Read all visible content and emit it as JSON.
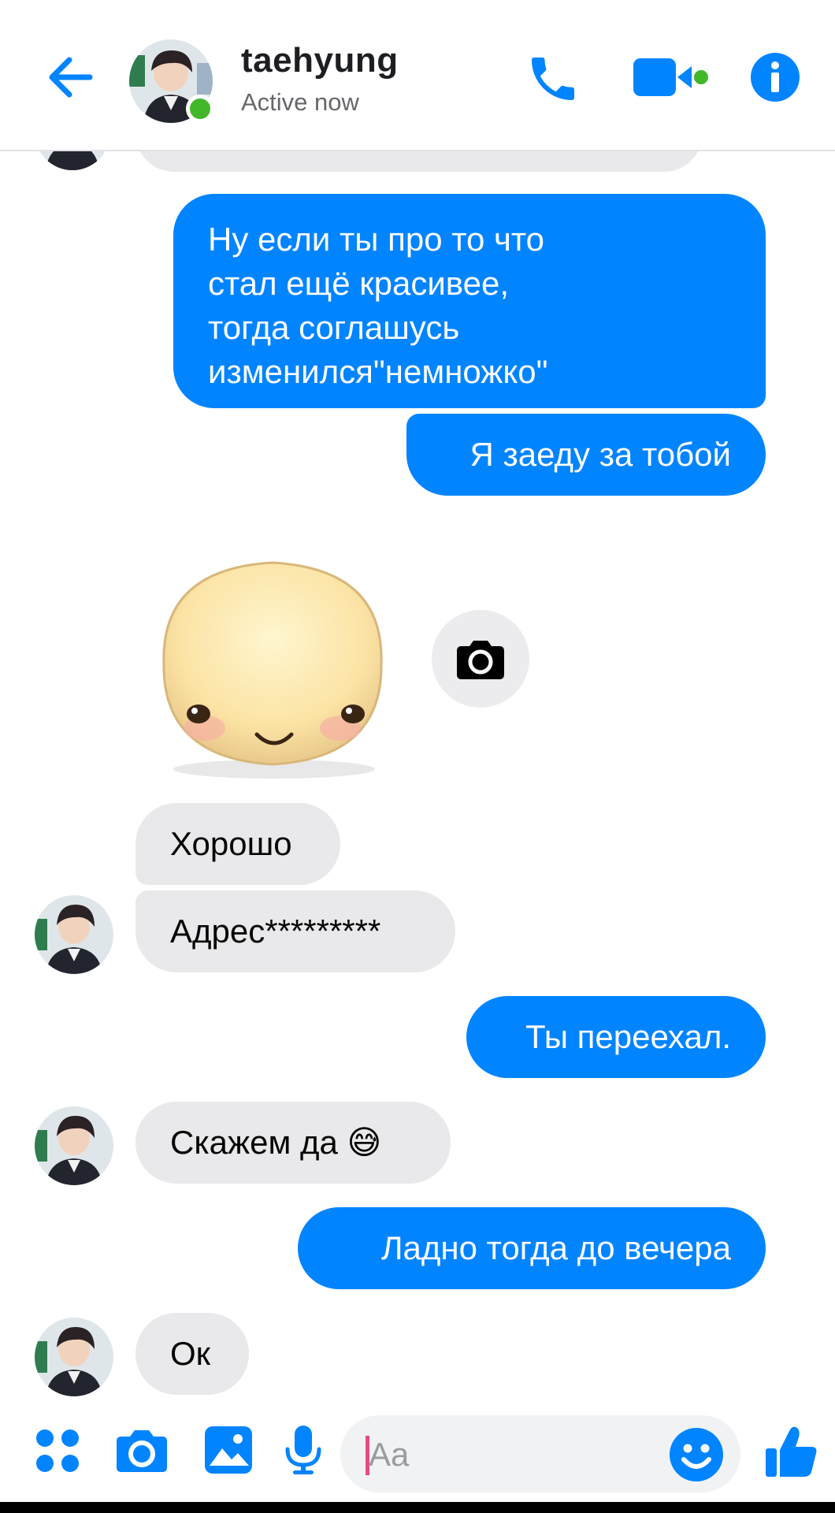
{
  "header": {
    "contact_name": "taehyung",
    "status": "Active now",
    "accent": "#0084ff",
    "online_color": "#42b72a"
  },
  "messages": [
    {
      "id": "m1",
      "direction": "outgoing",
      "lines": [
        "Ну если ты про то что",
        "стал ещё красивее,",
        "тогда соглашусь",
        "изменился\"немножко\""
      ]
    },
    {
      "id": "m2",
      "direction": "outgoing",
      "text": "Я заеду за тобой"
    },
    {
      "id": "m3",
      "direction": "incoming",
      "type": "sticker",
      "sticker": "smiling-face-sticker",
      "action_icon": "camera-icon"
    },
    {
      "id": "m4",
      "direction": "incoming",
      "text": "Хорошо"
    },
    {
      "id": "m5",
      "direction": "incoming",
      "text": "Адрес*********"
    },
    {
      "id": "m6",
      "direction": "outgoing",
      "text": "Ты переехал."
    },
    {
      "id": "m7",
      "direction": "incoming",
      "text": "Скажем да",
      "emoji": "😅"
    },
    {
      "id": "m8",
      "direction": "outgoing",
      "text": "Ладно тогда до вечера"
    },
    {
      "id": "m9",
      "direction": "incoming",
      "text": "Ок"
    }
  ],
  "composer": {
    "placeholder": "Aa",
    "icons": [
      "apps-icon",
      "camera-icon",
      "gallery-icon",
      "microphone-icon",
      "emoji-icon",
      "thumbs-up-icon"
    ]
  },
  "colors": {
    "outgoing_bubble": "#0084ff",
    "incoming_bubble": "#e9e9eb"
  }
}
